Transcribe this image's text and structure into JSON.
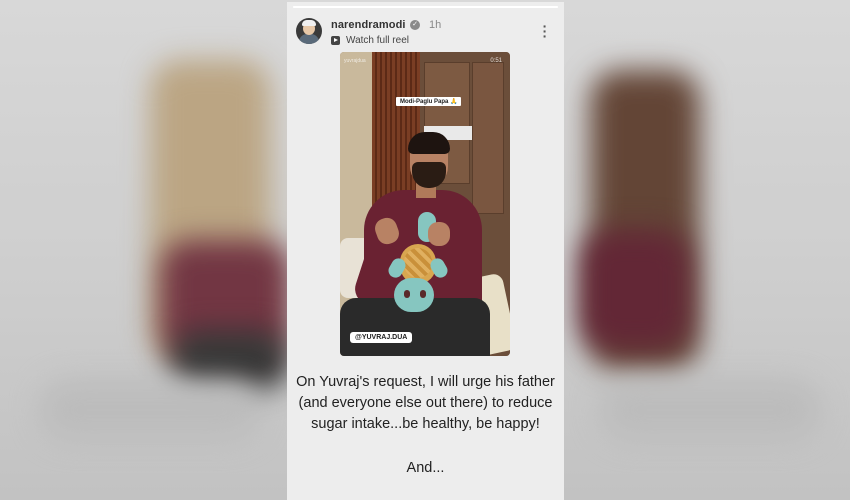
{
  "story": {
    "progress": 1.0,
    "username": "narendramodi",
    "verified_icon": "verified-badge-icon",
    "time": "1h",
    "reel_link_label": "Watch full reel",
    "more_icon": "more-vertical-icon"
  },
  "video": {
    "tag": "Modi-Paglu Papa 🙏",
    "watermark": "yuvrajdua",
    "timecode": "0:51",
    "handle": "@YUVRAJ.DUA"
  },
  "caption": {
    "text": "On Yuvraj's request, I will urge his father (and everyone else out there) to reduce sugar intake...be healthy, be happy!",
    "tail": "And..."
  },
  "colors": {
    "card_bg": "#ededed",
    "text": "#222222",
    "shirt": "#6a2232"
  }
}
